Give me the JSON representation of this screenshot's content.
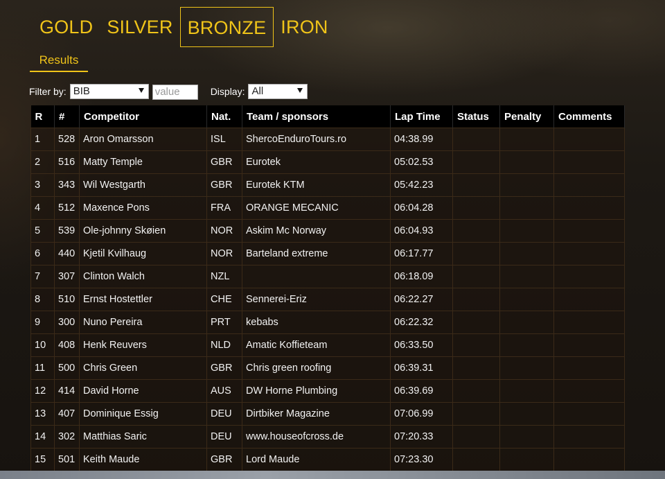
{
  "tabs": [
    "GOLD",
    "SILVER",
    "BRONZE",
    "IRON"
  ],
  "active_tab": "BRONZE",
  "subtab": "Results",
  "filter": {
    "label": "Filter by:",
    "selected": "BIB",
    "value_placeholder": "value",
    "display_label": "Display:",
    "display_selected": "All"
  },
  "table": {
    "headers": [
      "R",
      "#",
      "Competitor",
      "Nat.",
      "Team / sponsors",
      "Lap Time",
      "Status",
      "Penalty",
      "Comments"
    ],
    "rows": [
      [
        "1",
        "528",
        "Aron Omarsson",
        "ISL",
        "ShercoEnduroTours.ro",
        "04:38.99",
        "",
        "",
        ""
      ],
      [
        "2",
        "516",
        "Matty Temple",
        "GBR",
        "Eurotek",
        "05:02.53",
        "",
        "",
        ""
      ],
      [
        "3",
        "343",
        "Wil Westgarth",
        "GBR",
        "Eurotek KTM",
        "05:42.23",
        "",
        "",
        ""
      ],
      [
        "4",
        "512",
        "Maxence Pons",
        "FRA",
        "ORANGE MECANIC",
        "06:04.28",
        "",
        "",
        ""
      ],
      [
        "5",
        "539",
        "Ole-johnny Skøien",
        "NOR",
        "Askim Mc Norway",
        "06:04.93",
        "",
        "",
        ""
      ],
      [
        "6",
        "440",
        "Kjetil Kvilhaug",
        "NOR",
        "Barteland extreme",
        "06:17.77",
        "",
        "",
        ""
      ],
      [
        "7",
        "307",
        "Clinton Walch",
        "NZL",
        "",
        "06:18.09",
        "",
        "",
        ""
      ],
      [
        "8",
        "510",
        "Ernst Hostettler",
        "CHE",
        "Sennerei-Eriz",
        "06:22.27",
        "",
        "",
        ""
      ],
      [
        "9",
        "300",
        "Nuno Pereira",
        "PRT",
        "kebabs",
        "06:22.32",
        "",
        "",
        ""
      ],
      [
        "10",
        "408",
        "Henk Reuvers",
        "NLD",
        "Amatic Koffieteam",
        "06:33.50",
        "",
        "",
        ""
      ],
      [
        "11",
        "500",
        "Chris Green",
        "GBR",
        "Chris green roofing",
        "06:39.31",
        "",
        "",
        ""
      ],
      [
        "12",
        "414",
        "David Horne",
        "AUS",
        "DW Horne Plumbing",
        "06:39.69",
        "",
        "",
        ""
      ],
      [
        "13",
        "407",
        "Dominique Essig",
        "DEU",
        "Dirtbiker Magazine",
        "07:06.99",
        "",
        "",
        ""
      ],
      [
        "14",
        "302",
        "Matthias Saric",
        "DEU",
        "www.houseofcross.de",
        "07:20.33",
        "",
        "",
        ""
      ],
      [
        "15",
        "501",
        "Keith Maude",
        "GBR",
        "Lord Maude",
        "07:23.30",
        "",
        "",
        ""
      ]
    ]
  },
  "colors": {
    "accent": "#f0c419",
    "header_bg": "#000000",
    "row_border": "#3b2a18"
  }
}
